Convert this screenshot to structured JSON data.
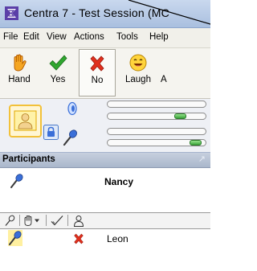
{
  "window": {
    "title": "Centra 7 - Test Session (MC"
  },
  "menu": [
    "File",
    "Edit",
    "View",
    "Actions",
    "Tools",
    "Help"
  ],
  "toolbar": {
    "buttons": [
      {
        "label": "Hand",
        "icon": "raised-hand-icon",
        "pressed": false
      },
      {
        "label": "Yes",
        "icon": "green-check-icon",
        "pressed": false
      },
      {
        "label": "No",
        "icon": "red-x-icon",
        "pressed": true
      },
      {
        "label": "Laugh",
        "icon": "laugh-face-icon",
        "pressed": false
      },
      {
        "label": "A",
        "icon": "",
        "pressed": false
      }
    ]
  },
  "audio": {
    "speaker_volume_fraction": 0.78,
    "mic_volume_fraction": 0.95
  },
  "participants": {
    "header": "Participants",
    "current_speaker": "Nancy",
    "rows": [
      {
        "name": "Leon",
        "status_icon": "red-x-icon"
      }
    ]
  },
  "colors": {
    "accent_blue": "#3a6fd8",
    "yes_green": "#2fa62f",
    "no_red": "#e0301e",
    "video_border": "#f2c13a"
  }
}
